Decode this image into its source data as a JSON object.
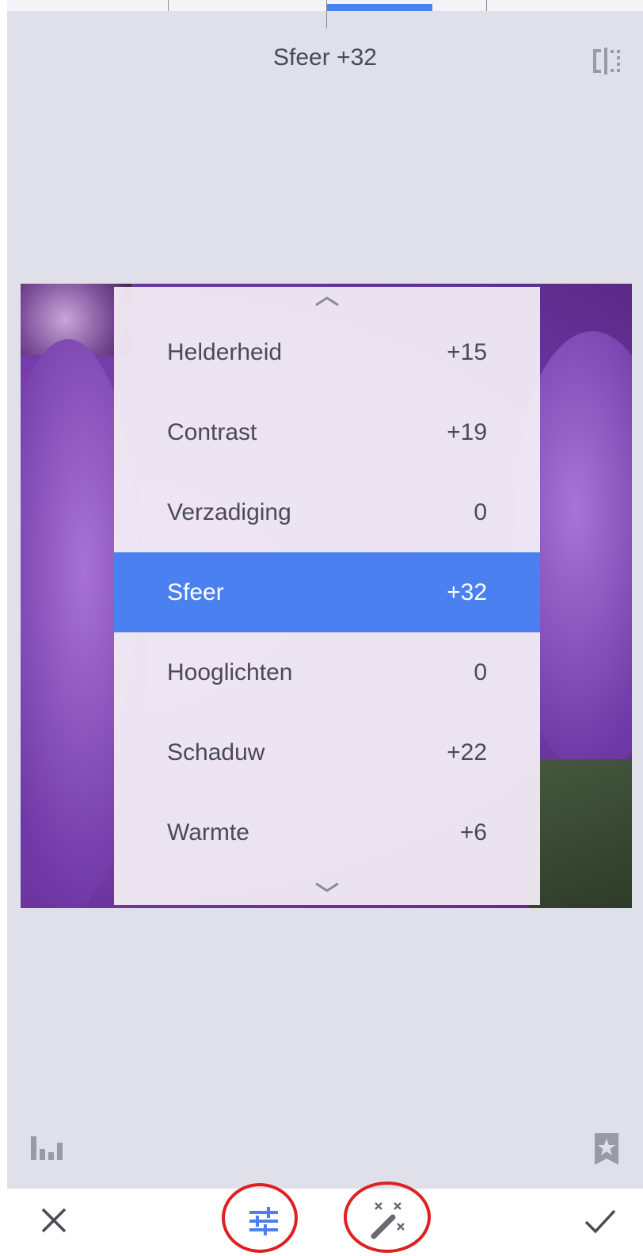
{
  "header": {
    "title": "Sfeer +32",
    "slider_value": 32
  },
  "menu": {
    "items": [
      {
        "label": "Helderheid",
        "value": "+15"
      },
      {
        "label": "Contrast",
        "value": "+19"
      },
      {
        "label": "Verzadiging",
        "value": "0"
      },
      {
        "label": "Sfeer",
        "value": "+32"
      },
      {
        "label": "Hooglichten",
        "value": "0"
      },
      {
        "label": "Schaduw",
        "value": "+22"
      },
      {
        "label": "Warmte",
        "value": "+6"
      }
    ],
    "selected_index": 3
  },
  "icons": {
    "compare": "compare-icon",
    "histogram": "histogram-icon",
    "bookmark": "bookmark-star-icon",
    "close": "close-icon",
    "tune": "tune-icon",
    "auto": "magic-wand-icon",
    "apply": "check-icon"
  },
  "colors": {
    "accent": "#4a80f0",
    "background": "#e0e0ea",
    "text": "#4a4a55",
    "annotation": "#e02020"
  }
}
